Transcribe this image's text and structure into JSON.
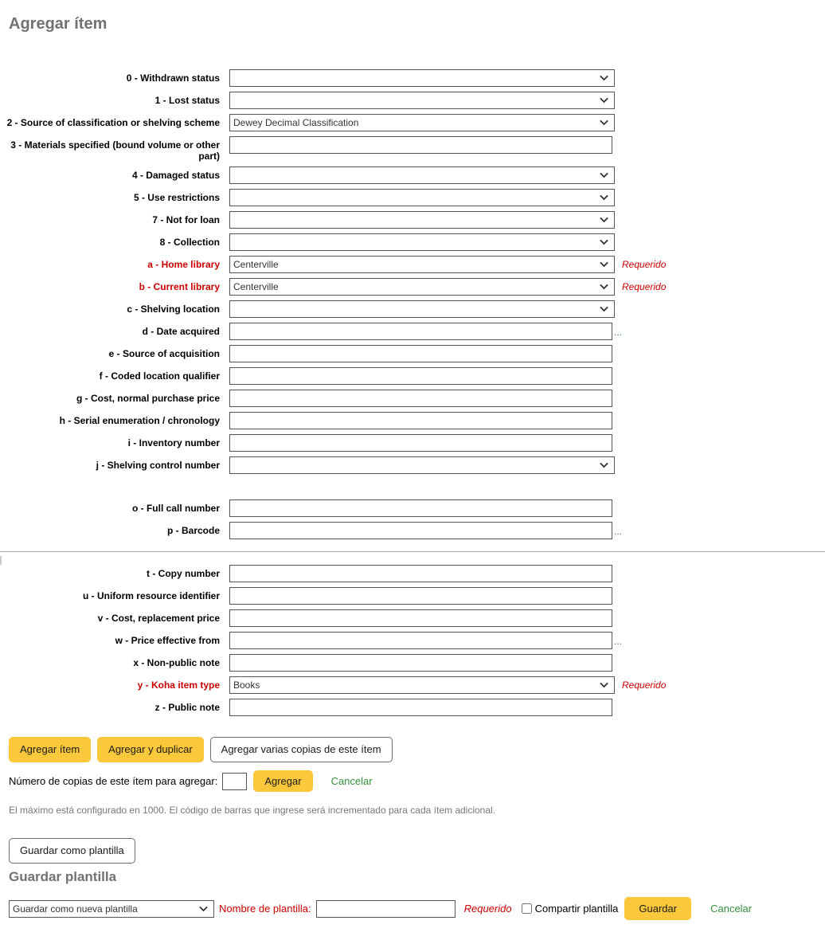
{
  "page": {
    "title": "Agregar ítem"
  },
  "form": {
    "fields": [
      {
        "label": "0 - Withdrawn status",
        "type": "select",
        "value": "",
        "required": false,
        "extra": ""
      },
      {
        "label": "1 - Lost status",
        "type": "select",
        "value": "",
        "required": false,
        "extra": ""
      },
      {
        "label": "2 - Source of classification or shelving scheme",
        "type": "select",
        "value": "Dewey Decimal Classification",
        "required": false,
        "extra": ""
      },
      {
        "label": "3 - Materials specified (bound volume or other part)",
        "type": "text",
        "value": "",
        "required": false,
        "extra": ""
      },
      {
        "label": "4 - Damaged status",
        "type": "select",
        "value": "",
        "required": false,
        "extra": ""
      },
      {
        "label": "5 - Use restrictions",
        "type": "select",
        "value": "",
        "required": false,
        "extra": ""
      },
      {
        "label": "7 - Not for loan",
        "type": "select",
        "value": "",
        "required": false,
        "extra": ""
      },
      {
        "label": "8 - Collection",
        "type": "select",
        "value": "",
        "required": false,
        "extra": ""
      },
      {
        "label": "a - Home library",
        "type": "select",
        "value": "Centerville",
        "required": true,
        "extra": ""
      },
      {
        "label": "b - Current library",
        "type": "select",
        "value": "Centerville",
        "required": true,
        "extra": ""
      },
      {
        "label": "c - Shelving location",
        "type": "select",
        "value": "",
        "required": false,
        "extra": ""
      },
      {
        "label": "d - Date acquired",
        "type": "text",
        "value": "",
        "required": false,
        "extra": "..."
      },
      {
        "label": "e - Source of acquisition",
        "type": "text",
        "value": "",
        "required": false,
        "extra": ""
      },
      {
        "label": "f - Coded location qualifier",
        "type": "text",
        "value": "",
        "required": false,
        "extra": ""
      },
      {
        "label": "g - Cost, normal purchase price",
        "type": "text",
        "value": "",
        "required": false,
        "extra": ""
      },
      {
        "label": "h - Serial enumeration / chronology",
        "type": "text",
        "value": "",
        "required": false,
        "extra": ""
      },
      {
        "label": "i - Inventory number",
        "type": "text",
        "value": "",
        "required": false,
        "extra": ""
      },
      {
        "label": "j - Shelving control number",
        "type": "select",
        "value": "",
        "required": false,
        "extra": ""
      },
      {
        "label": "",
        "type": "spacer",
        "value": "",
        "required": false,
        "extra": ""
      },
      {
        "label": "o - Full call number",
        "type": "text",
        "value": "",
        "required": false,
        "extra": ""
      },
      {
        "label": "p - Barcode",
        "type": "text",
        "value": "",
        "required": false,
        "extra": "..."
      },
      {
        "label": "",
        "type": "spacer",
        "value": "",
        "required": false,
        "extra": ""
      },
      {
        "label": "t - Copy number",
        "type": "text",
        "value": "",
        "required": false,
        "extra": ""
      },
      {
        "label": "u - Uniform resource identifier",
        "type": "text",
        "value": "",
        "required": false,
        "extra": ""
      },
      {
        "label": "v - Cost, replacement price",
        "type": "text",
        "value": "",
        "required": false,
        "extra": ""
      },
      {
        "label": "w - Price effective from",
        "type": "text",
        "value": "",
        "required": false,
        "extra": "..."
      },
      {
        "label": "x - Non-public note",
        "type": "text",
        "value": "",
        "required": false,
        "extra": ""
      },
      {
        "label": "y - Koha item type",
        "type": "select",
        "value": "Books",
        "required": true,
        "extra": ""
      },
      {
        "label": "z - Public note",
        "type": "text",
        "value": "",
        "required": false,
        "extra": ""
      }
    ],
    "required_note": "Requerido"
  },
  "actions": {
    "add_item": "Agregar ítem",
    "add_duplicate": "Agregar y duplicar",
    "add_multiple": "Agregar varias copias de este ítem",
    "copies_label": "Número de copias de este ítem para agregar:",
    "copies_value": "",
    "copies_add": "Agregar",
    "copies_cancel": "Cancelar",
    "hint": "El máximo está configurado en 1000. El código de barras que ingrese será incrementado para cada ítem adicional."
  },
  "template": {
    "save_as_template_button": "Guardar como plantilla",
    "heading": "Guardar plantilla",
    "select_value": "Guardar como nueva plantilla",
    "name_label": "Nombre de plantilla:",
    "name_value": "",
    "required_note": "Requerido",
    "share_label": "Compartir plantilla",
    "share_checked": false,
    "save_button": "Guardar",
    "cancel_link": "Cancelar"
  },
  "colors": {
    "accent_amber": "#fbc83c",
    "required_red": "#cc0000",
    "link_green": "#338f3f",
    "heading_gray": "#727272",
    "divider_gray": "#aaaaaa"
  }
}
